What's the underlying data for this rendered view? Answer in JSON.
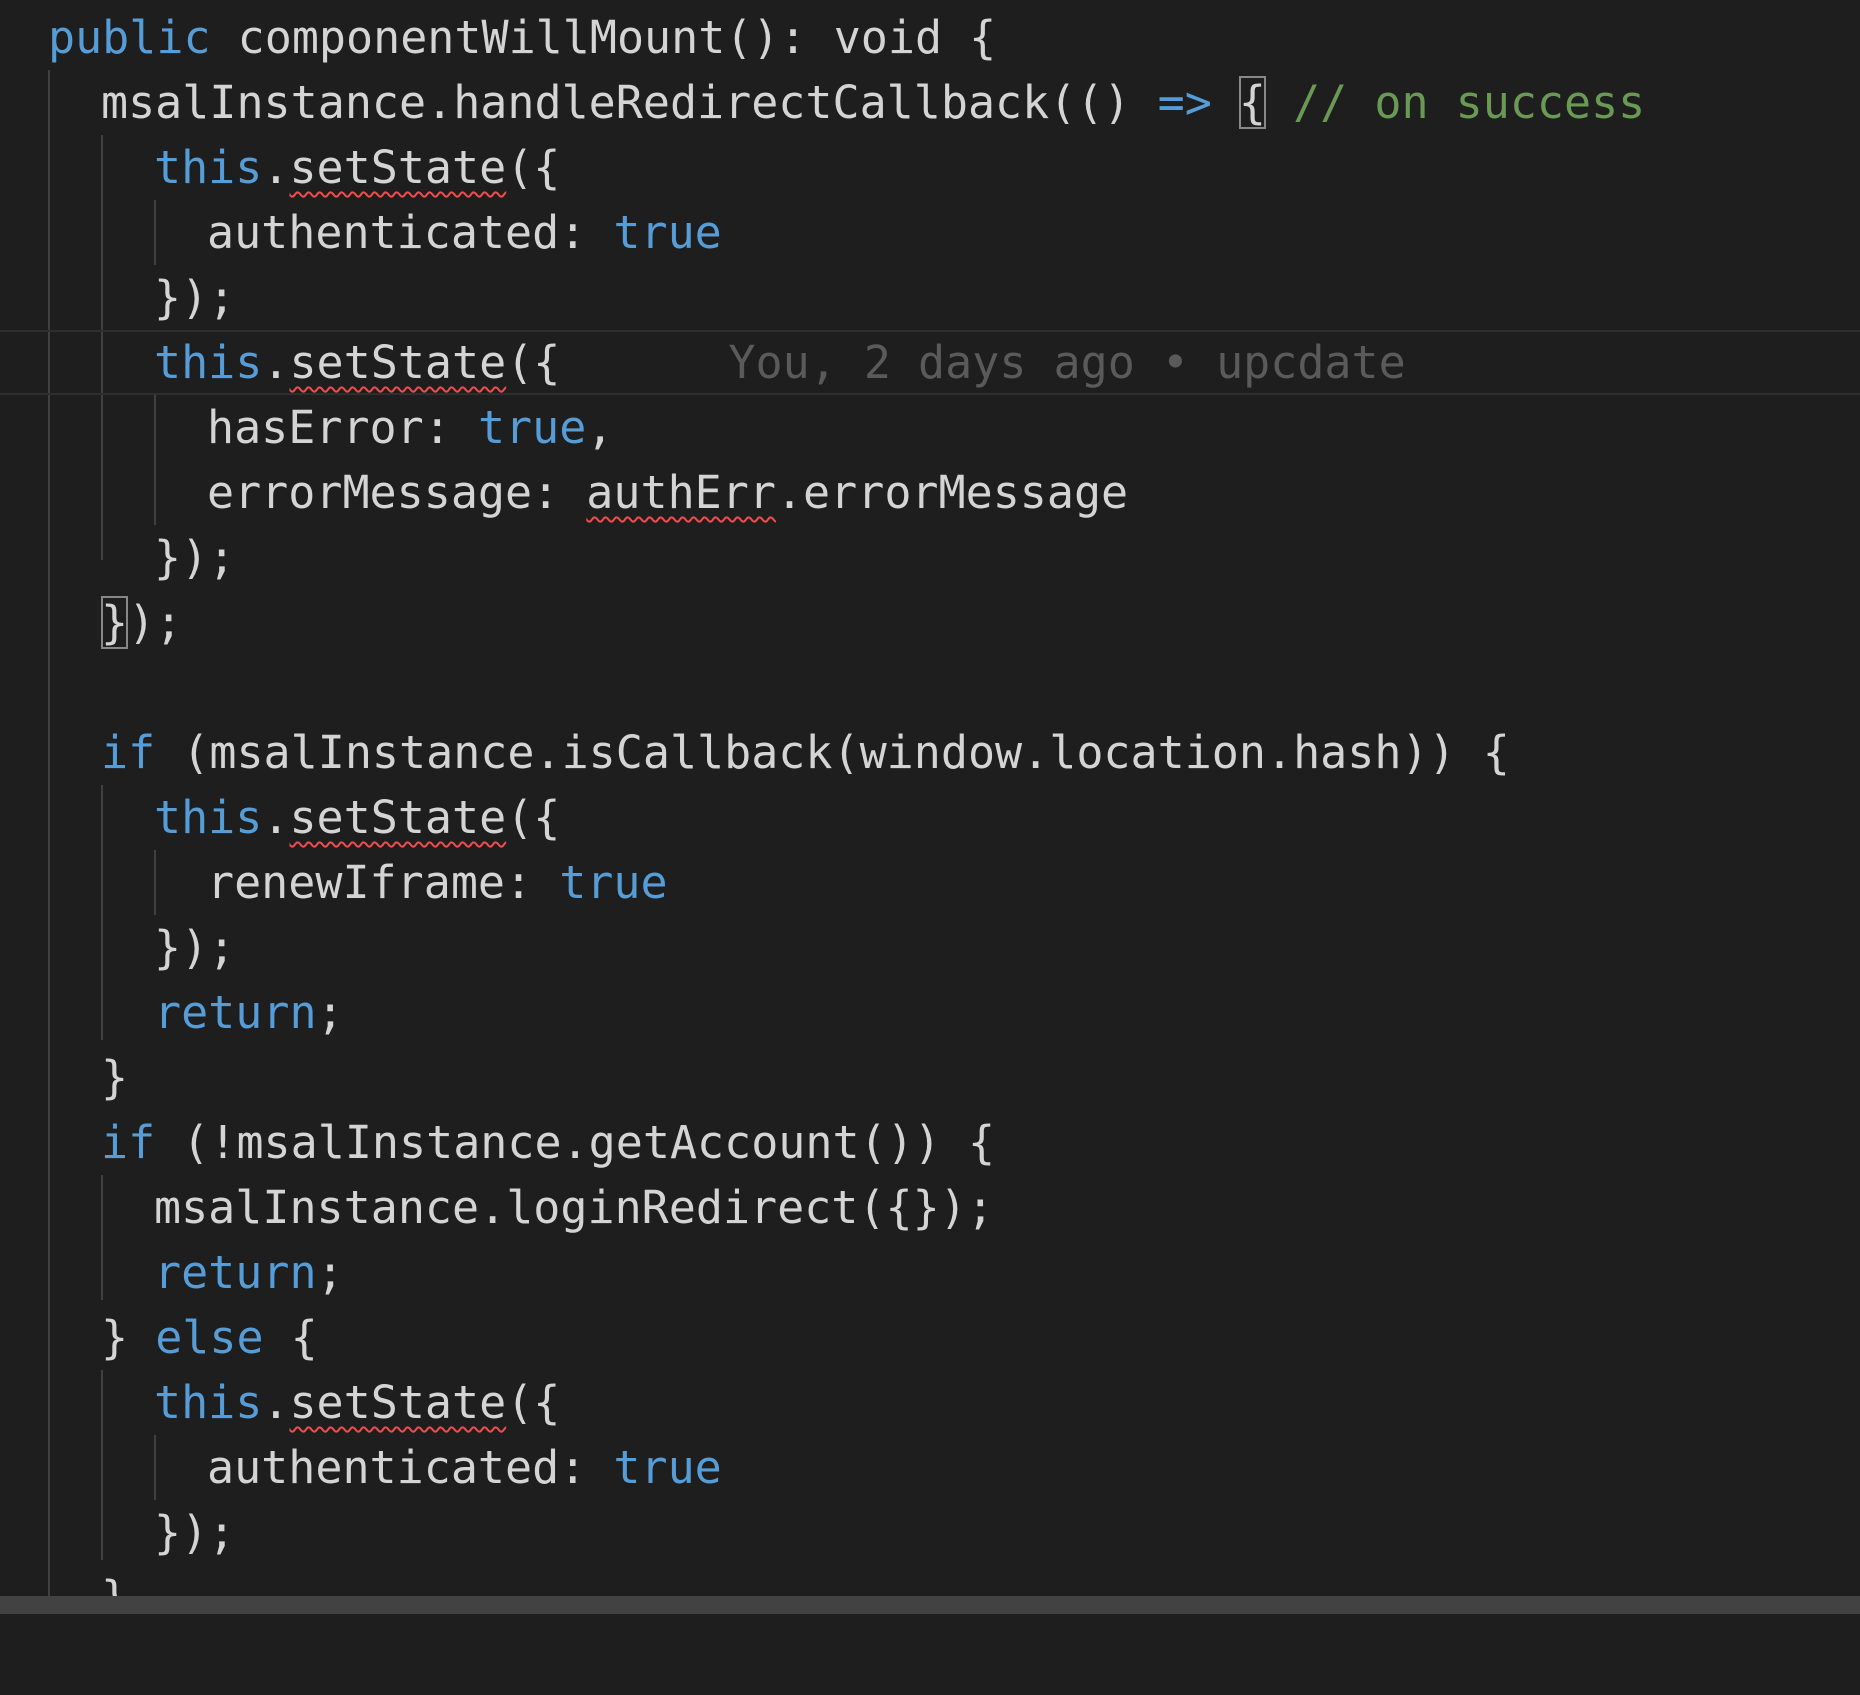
{
  "editor": {
    "lines": {
      "l1": {
        "public": "public",
        "name": " componentWillMount(): ",
        "void": "void",
        "brace": " {"
      },
      "l2": {
        "obj": "msalInstance.handleRedirectCallback(() ",
        "arrow": "=>",
        "sp": " ",
        "brace": "{",
        "comment": " // on success"
      },
      "l3": {
        "this": "this",
        "dot": ".",
        "fn": "setState",
        "rest": "({"
      },
      "l4": {
        "key": "authenticated: ",
        "val": "true"
      },
      "l5": {
        "text": "});"
      },
      "l6": {
        "this": "this",
        "dot": ".",
        "fn": "setState",
        "rest": "({",
        "blame": "You, 2 days ago • upcdate"
      },
      "l7": {
        "key": "hasError: ",
        "val": "true",
        "comma": ","
      },
      "l8": {
        "key": "errorMessage: ",
        "ref": "authErr",
        "rest": ".errorMessage"
      },
      "l9": {
        "text": "});"
      },
      "l10": {
        "brace": "}",
        "rest": ");"
      },
      "l12": {
        "kw": "if",
        "rest": " (msalInstance.isCallback(window.location.hash)) {"
      },
      "l13": {
        "this": "this",
        "dot": ".",
        "fn": "setState",
        "rest": "({"
      },
      "l14": {
        "key": "renewIframe: ",
        "val": "true"
      },
      "l15": {
        "text": "});"
      },
      "l16": {
        "kw": "return",
        "rest": ";"
      },
      "l17": {
        "text": "}"
      },
      "l18": {
        "kw": "if",
        "rest": " (!msalInstance.getAccount()) {"
      },
      "l19": {
        "text": "msalInstance.loginRedirect({});"
      },
      "l20": {
        "kw": "return",
        "rest": ";"
      },
      "l21": {
        "brace": "} ",
        "kw": "else",
        "rest": " {"
      },
      "l22": {
        "this": "this",
        "dot": ".",
        "fn": "setState",
        "rest": "({"
      },
      "l23": {
        "key": "authenticated: ",
        "val": "true"
      },
      "l24": {
        "text": "});"
      },
      "l25": {
        "text": "}"
      }
    }
  },
  "colors": {
    "background": "#1e1e1e",
    "keyword": "#569cd6",
    "comment": "#6a9955",
    "text": "#d4d4d4",
    "blame": "#5a5a5a",
    "error_squiggle": "#f14c4c"
  }
}
